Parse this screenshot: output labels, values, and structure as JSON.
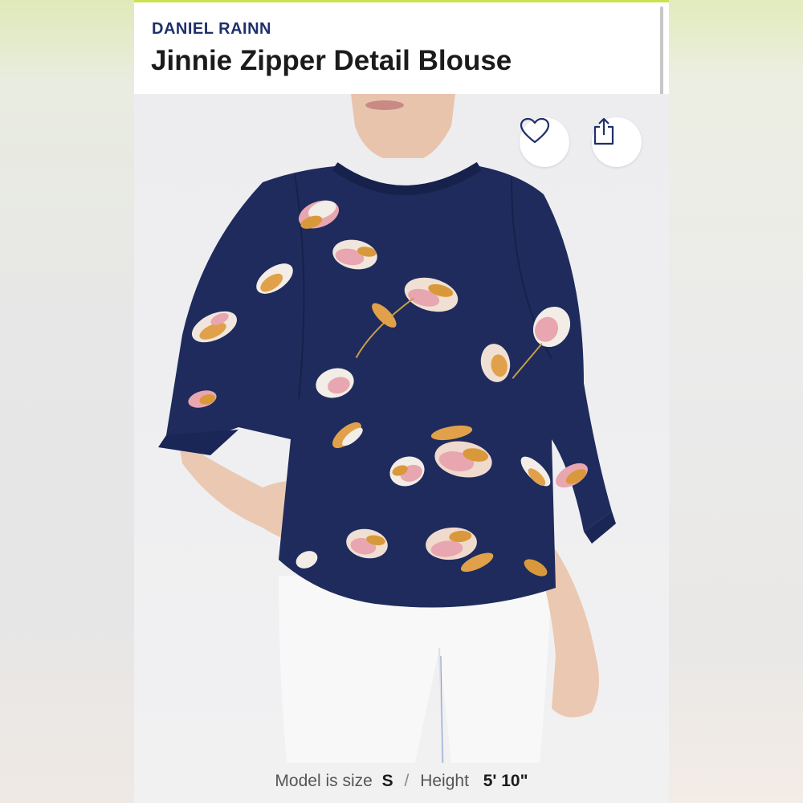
{
  "product": {
    "brand": "DANIEL RAINN",
    "title": "Jinnie Zipper Detail Blouse"
  },
  "actions": {
    "favorite_icon": "heart-outline-icon",
    "share_icon": "share-icon"
  },
  "photo": {
    "description_icon": "product-photo"
  },
  "caption": {
    "model_size_label": "Model is size",
    "model_size_value": "S",
    "separator": "/",
    "height_label": "Height",
    "height_value": "5' 10\""
  },
  "colors": {
    "brand": "#1f2f6b",
    "blouse_navy": "#1e2b5c",
    "accent": "#cbe24a"
  }
}
